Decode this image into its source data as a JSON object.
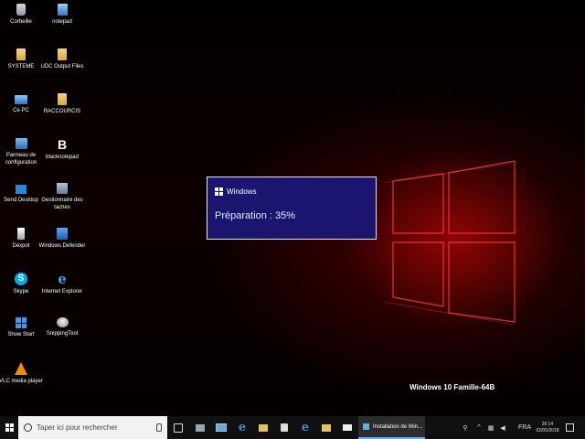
{
  "desktop": {
    "icons": [
      {
        "label": "Corbeille",
        "icon": "recycle-bin-icon"
      },
      {
        "label": "notepad",
        "icon": "notepad-icon"
      },
      {
        "label": "SYSTEME",
        "icon": "folder-icon"
      },
      {
        "label": "UDC Output Files",
        "icon": "folder-icon"
      },
      {
        "label": "Ce PC",
        "icon": "this-pc-icon"
      },
      {
        "label": "RACCOURCIS",
        "icon": "folder-icon"
      },
      {
        "label": "Panneau de configuration",
        "icon": "control-panel-icon"
      },
      {
        "label": "blacknotepad",
        "icon": "blacknotepad-icon"
      },
      {
        "label": "Send Desktop",
        "icon": "send-desktop-icon"
      },
      {
        "label": "Gestionnaire des taches",
        "icon": "task-manager-icon"
      },
      {
        "label": "Dexpot",
        "icon": "dexpot-icon"
      },
      {
        "label": "Windows Defender",
        "icon": "windows-defender-icon"
      },
      {
        "label": "Skype",
        "icon": "skype-icon"
      },
      {
        "label": "Internet Explorer",
        "icon": "internet-explorer-icon"
      },
      {
        "label": "Show Start",
        "icon": "show-start-icon"
      },
      {
        "label": "SnippingTool",
        "icon": "snipping-tool-icon"
      },
      {
        "label": "VLC media player",
        "icon": "vlc-icon"
      }
    ],
    "watermark": "Windows 10 Famille-64B"
  },
  "setup_dialog": {
    "title": "Windows",
    "status": "Préparation : 35%",
    "progress_percent": 35
  },
  "taskbar": {
    "search_placeholder": "Taper ici pour rechercher",
    "running_app_label": "Installation de Win...",
    "language": "FRA",
    "time": "20:14",
    "date": "02/05/2018",
    "pinned_icons": [
      "task-view-icon",
      "monitor-icon",
      "edge-icon",
      "file-explorer-icon",
      "store-icon",
      "edge-icon",
      "file-explorer-icon",
      "mail-icon"
    ]
  }
}
